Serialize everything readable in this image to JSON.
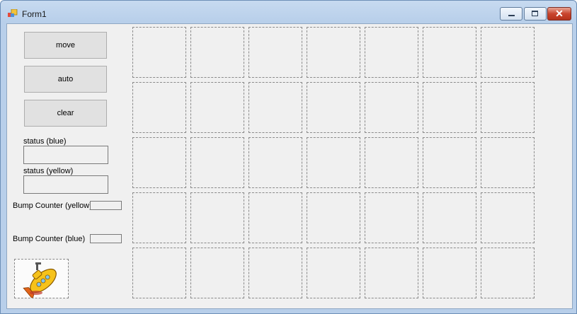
{
  "window": {
    "title": "Form1"
  },
  "buttons": {
    "move": "move",
    "auto": "auto",
    "clear": "clear"
  },
  "labels": {
    "status_blue": "status (blue)",
    "status_yellow": "status (yellow)",
    "bump_yellow": "Bump Counter (yellow)",
    "bump_blue": "Bump Counter (blue)"
  },
  "fields": {
    "status_blue_value": "",
    "status_yellow_value": "",
    "bump_yellow_value": "",
    "bump_blue_value": ""
  },
  "grid": {
    "rows": 5,
    "cols": 7
  },
  "image": {
    "icon": "yellow-submarine-icon"
  }
}
